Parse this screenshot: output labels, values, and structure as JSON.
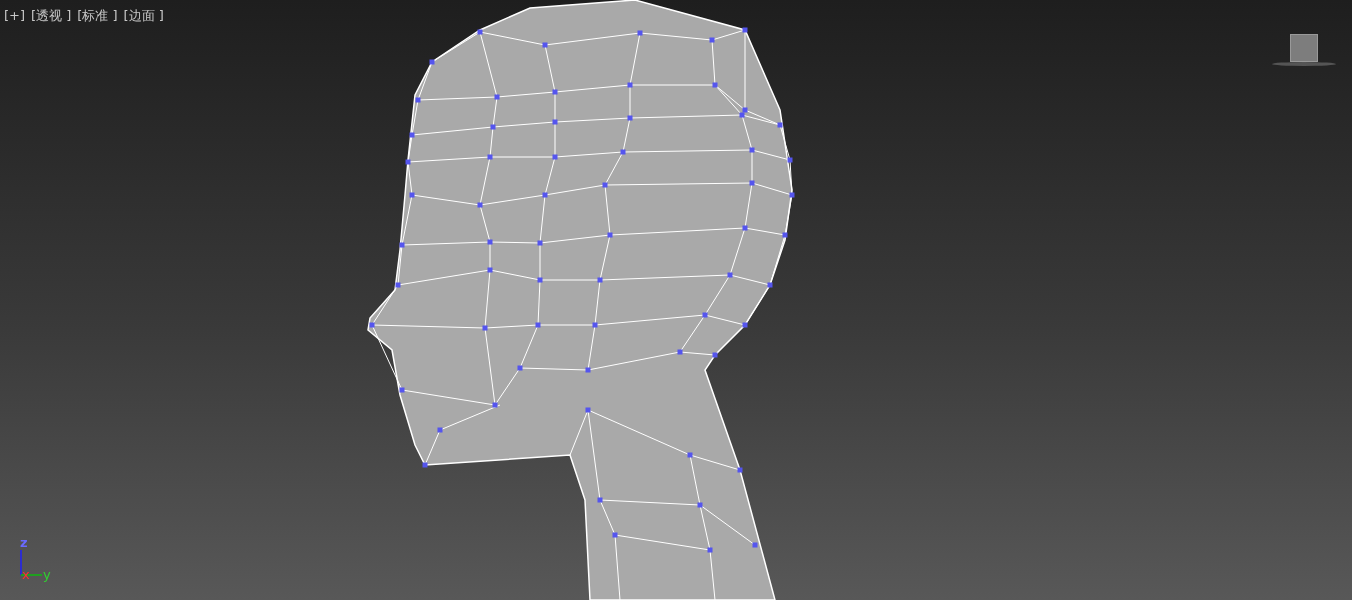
{
  "viewport": {
    "labels": [
      "[+]",
      "[透视 ]",
      "[标准 ]",
      "[边面 ]"
    ],
    "axis_gizmo": [
      {
        "kind": "z",
        "label": "z"
      },
      {
        "kind": "x",
        "label": "x"
      },
      {
        "kind": "y",
        "label": "y"
      }
    ]
  }
}
